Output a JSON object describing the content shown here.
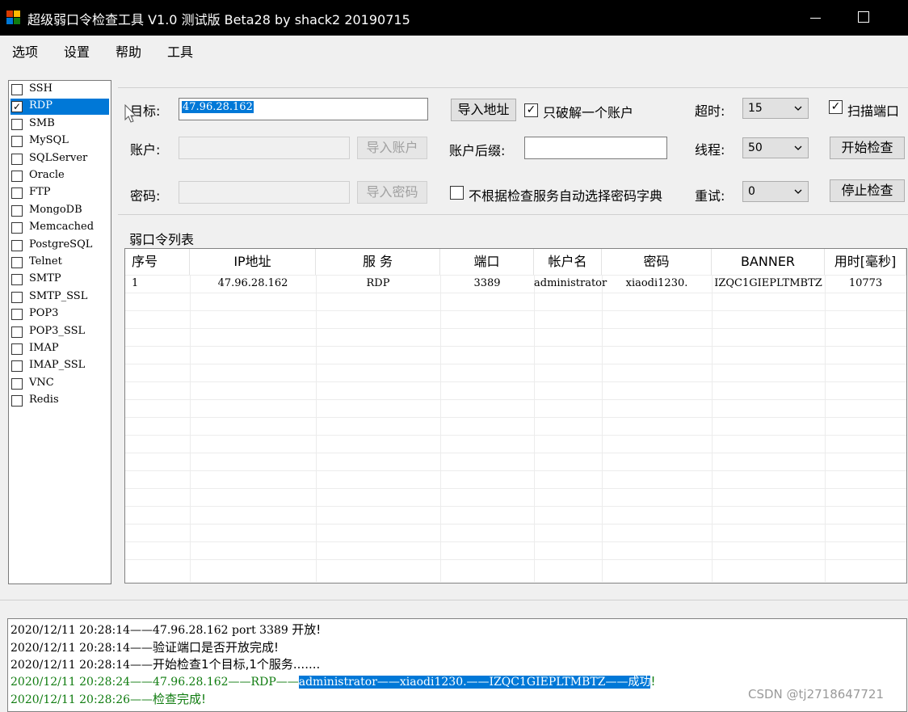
{
  "window": {
    "title": "超级弱口令检查工具 V1.0 测试版 Beta28 by shack2 20190715",
    "icon_colors": [
      "#d83b01",
      "#ffb900",
      "#0078d7",
      "#107c10"
    ]
  },
  "menu": [
    "选项",
    "设置",
    "帮助",
    "工具"
  ],
  "services": [
    {
      "label": "SSH",
      "checked": false
    },
    {
      "label": "RDP",
      "checked": true,
      "selected": true
    },
    {
      "label": "SMB",
      "checked": false
    },
    {
      "label": "MySQL",
      "checked": false
    },
    {
      "label": "SQLServer",
      "checked": false
    },
    {
      "label": "Oracle",
      "checked": false
    },
    {
      "label": "FTP",
      "checked": false
    },
    {
      "label": "MongoDB",
      "checked": false
    },
    {
      "label": "Memcached",
      "checked": false
    },
    {
      "label": "PostgreSQL",
      "checked": false
    },
    {
      "label": "Telnet",
      "checked": false
    },
    {
      "label": "SMTP",
      "checked": false
    },
    {
      "label": "SMTP_SSL",
      "checked": false
    },
    {
      "label": "POP3",
      "checked": false
    },
    {
      "label": "POP3_SSL",
      "checked": false
    },
    {
      "label": "IMAP",
      "checked": false
    },
    {
      "label": "IMAP_SSL",
      "checked": false
    },
    {
      "label": "VNC",
      "checked": false
    },
    {
      "label": "Redis",
      "checked": false
    }
  ],
  "form": {
    "target_label": "目标:",
    "target_value": "47.96.28.162",
    "account_label": "账户:",
    "account_value": "",
    "password_label": "密码:",
    "password_value": "",
    "import_address": "导入地址",
    "import_account": "导入账户",
    "import_password": "导入密码",
    "only_one_account_label": "只破解一个账户",
    "only_one_account_checked": true,
    "account_suffix_label": "账户后缀:",
    "account_suffix_value": "",
    "no_auto_dict_label": "不根据检查服务自动选择密码字典",
    "no_auto_dict_checked": false,
    "timeout_label": "超时:",
    "timeout_value": "15",
    "threads_label": "线程:",
    "threads_value": "50",
    "retry_label": "重试:",
    "retry_value": "0",
    "scan_port_label": "扫描端口",
    "scan_port_checked": true,
    "start_button": "开始检查",
    "stop_button": "停止检查"
  },
  "results": {
    "title": "弱口令列表",
    "columns": [
      "序号",
      "IP地址",
      "服 务",
      "端口",
      "帐户名",
      "密码",
      "BANNER",
      "用时[毫秒]"
    ],
    "rows": [
      [
        "1",
        "47.96.28.162",
        "RDP",
        "3389",
        "administrator",
        "xiaodi1230.",
        "IZQC1GIEPLTMBTZ",
        "10773"
      ]
    ]
  },
  "log": {
    "lines": [
      {
        "time": "2020/12/11 20:28:14",
        "sep": "——",
        "text_a": "47.96.28.162 port 3389 ",
        "text_cn": "开放!",
        "color": "#000000"
      },
      {
        "time": "2020/12/11 20:28:14",
        "sep": "——",
        "text_a": "",
        "text_cn": "验证端口是否开放完成!",
        "color": "#000000"
      },
      {
        "time": "2020/12/11 20:28:14",
        "sep": "——",
        "text_a": "",
        "text_cn": "开始检查1个目标,1个服务.......",
        "color": "#000000"
      },
      {
        "time": "2020/12/11 20:28:24",
        "sep": "——",
        "text_a": "47.96.28.162——RDP——",
        "highlight": "administrator——xiaodi1230.——IZQC1GIEPLTMBTZ——成功",
        "text_cn": "!",
        "color": "#107c10"
      },
      {
        "time": "2020/12/11 20:28:26",
        "sep": "——",
        "text_a": "",
        "text_cn": "检查完成!",
        "color": "#107c10"
      }
    ]
  },
  "watermark": "CSDN @tj2718647721"
}
